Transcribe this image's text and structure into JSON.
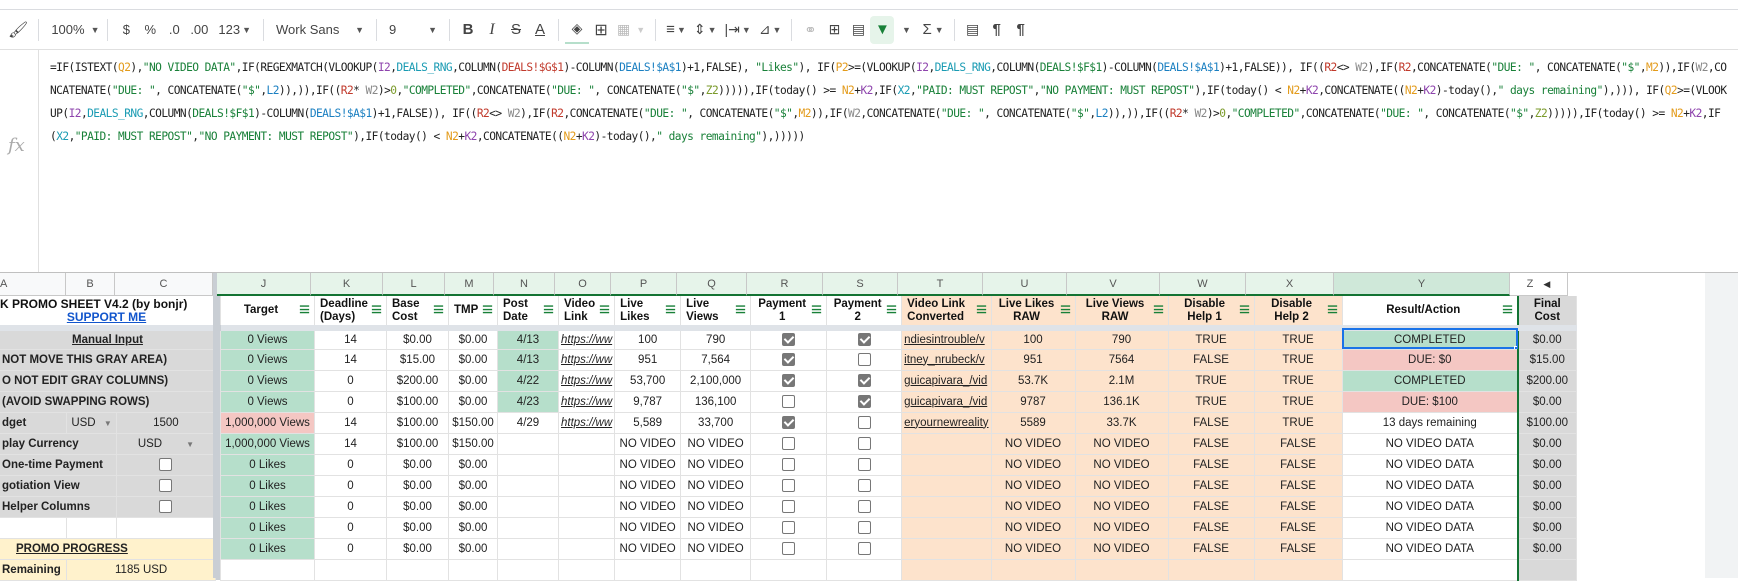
{
  "toolbar": {
    "zoom": "100%",
    "currency": "$",
    "percent": "%",
    "dec_decrease": ".0",
    "dec_increase": ".00",
    "format_more": "123",
    "font": "Work Sans",
    "font_size": "9",
    "bold": "B",
    "italic": "I",
    "strike": "S",
    "text_color": "A",
    "sum": "Σ",
    "para1": "¶",
    "para2": "¶"
  },
  "formula_bar": {
    "fx": "fx",
    "segments": [
      [
        "=IF(ISTEXT(",
        ""
      ],
      [
        "Q2",
        "c-orange"
      ],
      [
        "),",
        ""
      ],
      [
        "\"NO VIDEO DATA\"",
        "c-green"
      ],
      [
        ",IF(REGEXMATCH(VLOOKUP(",
        ""
      ],
      [
        "I2",
        "c-purple"
      ],
      [
        ",",
        ""
      ],
      [
        "DEALS_RNG",
        "c-teal"
      ],
      [
        ",COLUMN(",
        ""
      ],
      [
        "DEALS!$G$1",
        "c-red"
      ],
      [
        ")-COLUMN(",
        ""
      ],
      [
        "DEALS!$A$1",
        "c-blue"
      ],
      [
        ")+1,FALSE), ",
        ""
      ],
      [
        "\"Likes\"",
        "c-green"
      ],
      [
        "), IF(",
        ""
      ],
      [
        "P2",
        "c-orange"
      ],
      [
        ">=(VLOOKUP(",
        ""
      ],
      [
        "I2",
        "c-purple"
      ],
      [
        ",",
        ""
      ],
      [
        "DEALS_RNG",
        "c-teal"
      ],
      [
        ",COLUMN(",
        ""
      ],
      [
        "DEALS!$F$1",
        "c-green"
      ],
      [
        ")-COLUMN(",
        ""
      ],
      [
        "DEALS!$A$1",
        "c-blue"
      ],
      [
        ")+1,FALSE)), IF((",
        ""
      ],
      [
        "R2",
        "c-red"
      ],
      [
        "<> ",
        ""
      ],
      [
        "W2",
        "c-gray"
      ],
      [
        "),IF(",
        ""
      ],
      [
        "R2",
        "c-red"
      ],
      [
        ",CONCATENATE(",
        ""
      ],
      [
        "\"DUE: \"",
        "c-green"
      ],
      [
        ", CONCATENATE(",
        ""
      ],
      [
        "\"$\"",
        "c-green"
      ],
      [
        ",",
        ""
      ],
      [
        "M2",
        "c-orange"
      ],
      [
        ")),IF(",
        ""
      ],
      [
        "W2",
        "c-gray"
      ],
      [
        ",CONCATENATE(",
        ""
      ],
      [
        "\"DUE: \"",
        "c-green"
      ],
      [
        ", CONCATENATE(",
        ""
      ],
      [
        "\"$\"",
        "c-green"
      ],
      [
        ",",
        ""
      ],
      [
        "L2",
        "c-blue"
      ],
      [
        ")),)),IF((",
        ""
      ],
      [
        "R2",
        "c-red"
      ],
      [
        "* ",
        ""
      ],
      [
        "W2",
        "c-gray"
      ],
      [
        ")>",
        ""
      ],
      [
        "0",
        "c-olive"
      ],
      [
        ",",
        ""
      ],
      [
        "\"COMPLETED\"",
        "c-green"
      ],
      [
        ",CONCATENATE(",
        ""
      ],
      [
        "\"DUE: \"",
        "c-green"
      ],
      [
        ", CONCATENATE(",
        ""
      ],
      [
        "\"$\"",
        "c-green"
      ],
      [
        ",",
        ""
      ],
      [
        "Z2",
        "c-olive"
      ],
      [
        "))))),IF(today() >= ",
        ""
      ],
      [
        "N2",
        "c-orange"
      ],
      [
        "+",
        ""
      ],
      [
        "K2",
        "c-purple"
      ],
      [
        ",IF(",
        ""
      ],
      [
        "X2",
        "c-teal"
      ],
      [
        ",",
        ""
      ],
      [
        "\"PAID: MUST REPOST\"",
        "c-green"
      ],
      [
        ",",
        ""
      ],
      [
        "\"NO PAYMENT: MUST REPOST\"",
        "c-green"
      ],
      [
        "),IF(today() < ",
        ""
      ],
      [
        "N2",
        "c-orange"
      ],
      [
        "+",
        ""
      ],
      [
        "K2",
        "c-purple"
      ],
      [
        ",CONCATENATE((",
        ""
      ],
      [
        "N2",
        "c-orange"
      ],
      [
        "+",
        ""
      ],
      [
        "K2",
        "c-purple"
      ],
      [
        ")-today(),",
        ""
      ],
      [
        "\" days remaining\"",
        "c-green"
      ],
      [
        "),))), IF(",
        ""
      ],
      [
        "Q2",
        "c-orange"
      ],
      [
        ">=(VLOOKUP(",
        ""
      ],
      [
        "I2",
        "c-purple"
      ],
      [
        ",",
        ""
      ],
      [
        "DEALS_RNG",
        "c-teal"
      ],
      [
        ",COLUMN(",
        ""
      ],
      [
        "DEALS!$F$1",
        "c-green"
      ],
      [
        ")-COLUMN(",
        ""
      ],
      [
        "DEALS!$A$1",
        "c-blue"
      ],
      [
        ")+1,FALSE)), IF((",
        ""
      ],
      [
        "R2",
        "c-red"
      ],
      [
        "<> ",
        ""
      ],
      [
        "W2",
        "c-gray"
      ],
      [
        "),IF(",
        ""
      ],
      [
        "R2",
        "c-red"
      ],
      [
        ",CONCATENATE(",
        ""
      ],
      [
        "\"DUE: \"",
        "c-green"
      ],
      [
        ", CONCATENATE(",
        ""
      ],
      [
        "\"$\"",
        "c-green"
      ],
      [
        ",",
        ""
      ],
      [
        "M2",
        "c-orange"
      ],
      [
        ")),IF(",
        ""
      ],
      [
        "W2",
        "c-gray"
      ],
      [
        ",CONCATENATE(",
        ""
      ],
      [
        "\"DUE: \"",
        "c-green"
      ],
      [
        ", CONCATENATE(",
        ""
      ],
      [
        "\"$\"",
        "c-green"
      ],
      [
        ",",
        ""
      ],
      [
        "L2",
        "c-blue"
      ],
      [
        ")),)),IF((",
        ""
      ],
      [
        "R2",
        "c-red"
      ],
      [
        "* ",
        ""
      ],
      [
        "W2",
        "c-gray"
      ],
      [
        ")>",
        ""
      ],
      [
        "0",
        "c-olive"
      ],
      [
        ",",
        ""
      ],
      [
        "\"COMPLETED\"",
        "c-green"
      ],
      [
        ",CONCATENATE(",
        ""
      ],
      [
        "\"DUE: \"",
        "c-green"
      ],
      [
        ", CONCATENATE(",
        ""
      ],
      [
        "\"$\"",
        "c-green"
      ],
      [
        ",",
        ""
      ],
      [
        "Z2",
        "c-olive"
      ],
      [
        "))))),IF(today() >= ",
        ""
      ],
      [
        "N2",
        "c-orange"
      ],
      [
        "+",
        ""
      ],
      [
        "K2",
        "c-purple"
      ],
      [
        ",IF(",
        ""
      ],
      [
        "X2",
        "c-teal"
      ],
      [
        ",",
        ""
      ],
      [
        "\"PAID: MUST REPOST\"",
        "c-green"
      ],
      [
        ",",
        ""
      ],
      [
        "\"NO PAYMENT: MUST REPOST\"",
        "c-green"
      ],
      [
        "),IF(today() < ",
        ""
      ],
      [
        "N2",
        "c-orange"
      ],
      [
        "+",
        ""
      ],
      [
        "K2",
        "c-purple"
      ],
      [
        ",CONCATENATE((",
        ""
      ],
      [
        "N2",
        "c-orange"
      ],
      [
        "+",
        ""
      ],
      [
        "K2",
        "c-purple"
      ],
      [
        ")-today(),",
        ""
      ],
      [
        "\" days remaining\"",
        "c-green"
      ],
      [
        "),)))))",
        ""
      ]
    ]
  },
  "columns": [
    "A",
    "B",
    "C",
    "J",
    "K",
    "L",
    "M",
    "N",
    "O",
    "P",
    "Q",
    "R",
    "S",
    "T",
    "U",
    "V",
    "W",
    "X",
    "Y",
    "Z"
  ],
  "left_panel": {
    "title": "K PROMO SHEET V4.2 (by bonjr)",
    "support_link": "SUPPORT ME",
    "rows": [
      {
        "label": "Manual Input",
        "style": "manual"
      },
      {
        "label": "NOT MOVE THIS GRAY AREA)",
        "style": "warn"
      },
      {
        "label": "O NOT EDIT GRAY COLUMNS)",
        "style": "warn"
      },
      {
        "label": "(AVOID SWAPPING ROWS)",
        "style": "warn"
      },
      {
        "label": "dget",
        "b": "USD",
        "c": "1500",
        "style": "budget"
      },
      {
        "label": "play Currency",
        "c": "USD",
        "style": "currency"
      },
      {
        "label": "One-time Payment",
        "checkbox": false,
        "style": "check"
      },
      {
        "label": "gotiation View",
        "checkbox": false,
        "style": "check"
      },
      {
        "label": "Helper Columns",
        "checkbox": false,
        "style": "check"
      },
      {
        "label": "",
        "style": "blank"
      },
      {
        "label": "PROMO PROGRESS",
        "style": "progress"
      },
      {
        "label": "Remaining",
        "c": "1185 USD",
        "style": "remaining"
      }
    ]
  },
  "headers": {
    "J": "Target",
    "K": "Deadline (Days)",
    "L": "Base Cost",
    "M": "TMP",
    "N": "Post Date",
    "O": "Video Link",
    "P": "Live Likes",
    "Q": "Live Views",
    "R": "Payment 1",
    "S": "Payment 2",
    "T": "Video Link Converted",
    "U": "Live Likes RAW",
    "V": "Live Views RAW",
    "W": "Disable Help 1",
    "X": "Disable Help 2",
    "Y": "Result/Action",
    "Z": "Final Cost"
  },
  "rows": [
    {
      "J": "0 Views",
      "K": "14",
      "L": "$0.00",
      "M": "$0.00",
      "N": "4/13",
      "O": "https://ww",
      "P": "100",
      "Q": "790",
      "R": true,
      "S": true,
      "T": "ndiesintrouble/v",
      "U": "100",
      "V": "790",
      "W": "TRUE",
      "X": "TRUE",
      "Y": "COMPLETED",
      "Y_status": "green",
      "Z": "$0.00",
      "J_status": "green",
      "N_status": "green"
    },
    {
      "J": "0 Views",
      "K": "14",
      "L": "$15.00",
      "M": "$0.00",
      "N": "4/13",
      "O": "https://ww",
      "P": "951",
      "Q": "7,564",
      "R": true,
      "S": false,
      "T": "itney_nrubeck/v",
      "U": "951",
      "V": "7564",
      "W": "FALSE",
      "X": "TRUE",
      "Y": "DUE: $0",
      "Y_status": "pink",
      "Z": "$15.00",
      "J_status": "green",
      "N_status": "green"
    },
    {
      "J": "0 Views",
      "K": "0",
      "L": "$200.00",
      "M": "$0.00",
      "N": "4/22",
      "O": "https://ww",
      "P": "53,700",
      "Q": "2,100,000",
      "R": true,
      "S": true,
      "T": "guicapivara_/vid",
      "U": "53.7K",
      "V": "2.1M",
      "W": "TRUE",
      "X": "TRUE",
      "Y": "COMPLETED",
      "Y_status": "green",
      "Z": "$200.00",
      "J_status": "green",
      "N_status": "green"
    },
    {
      "J": "0 Views",
      "K": "0",
      "L": "$100.00",
      "M": "$0.00",
      "N": "4/23",
      "O": "https://ww",
      "P": "9,787",
      "Q": "136,100",
      "R": false,
      "S": true,
      "T": "guicapivara_/vid",
      "U": "9787",
      "V": "136.1K",
      "W": "TRUE",
      "X": "TRUE",
      "Y": "DUE: $100",
      "Y_status": "pink",
      "Z": "$0.00",
      "J_status": "green",
      "N_status": "green"
    },
    {
      "J": "1,000,000 Views",
      "K": "14",
      "L": "$100.00",
      "M": "$150.00",
      "N": "4/29",
      "O": "https://ww",
      "P": "5,589",
      "Q": "33,700",
      "R": true,
      "S": false,
      "T": "eryournewreality",
      "U": "5589",
      "V": "33.7K",
      "W": "FALSE",
      "X": "TRUE",
      "Y": "13 days remaining",
      "Y_status": "white",
      "Z": "$100.00",
      "J_status": "pink",
      "N_status": "white"
    },
    {
      "J": "1,000,000 Views",
      "K": "14",
      "L": "$100.00",
      "M": "$150.00",
      "N": "",
      "O": "",
      "P": "NO VIDEO",
      "Q": "NO VIDEO",
      "R": false,
      "S": false,
      "T": "",
      "U": "NO VIDEO",
      "V": "NO VIDEO",
      "W": "FALSE",
      "X": "FALSE",
      "Y": "NO VIDEO DATA",
      "Y_status": "white",
      "Z": "$0.00",
      "J_status": "green",
      "N_status": "white"
    },
    {
      "J": "0 Likes",
      "K": "0",
      "L": "$0.00",
      "M": "$0.00",
      "N": "",
      "O": "",
      "P": "NO VIDEO",
      "Q": "NO VIDEO",
      "R": false,
      "S": false,
      "T": "",
      "U": "NO VIDEO",
      "V": "NO VIDEO",
      "W": "FALSE",
      "X": "FALSE",
      "Y": "NO VIDEO DATA",
      "Y_status": "white",
      "Z": "$0.00",
      "J_status": "green",
      "N_status": "white"
    },
    {
      "J": "0 Likes",
      "K": "0",
      "L": "$0.00",
      "M": "$0.00",
      "N": "",
      "O": "",
      "P": "NO VIDEO",
      "Q": "NO VIDEO",
      "R": false,
      "S": false,
      "T": "",
      "U": "NO VIDEO",
      "V": "NO VIDEO",
      "W": "FALSE",
      "X": "FALSE",
      "Y": "NO VIDEO DATA",
      "Y_status": "white",
      "Z": "$0.00",
      "J_status": "green",
      "N_status": "white"
    },
    {
      "J": "0 Likes",
      "K": "0",
      "L": "$0.00",
      "M": "$0.00",
      "N": "",
      "O": "",
      "P": "NO VIDEO",
      "Q": "NO VIDEO",
      "R": false,
      "S": false,
      "T": "",
      "U": "NO VIDEO",
      "V": "NO VIDEO",
      "W": "FALSE",
      "X": "FALSE",
      "Y": "NO VIDEO DATA",
      "Y_status": "white",
      "Z": "$0.00",
      "J_status": "green",
      "N_status": "white"
    },
    {
      "J": "0 Likes",
      "K": "0",
      "L": "$0.00",
      "M": "$0.00",
      "N": "",
      "O": "",
      "P": "NO VIDEO",
      "Q": "NO VIDEO",
      "R": false,
      "S": false,
      "T": "",
      "U": "NO VIDEO",
      "V": "NO VIDEO",
      "W": "FALSE",
      "X": "FALSE",
      "Y": "NO VIDEO DATA",
      "Y_status": "white",
      "Z": "$0.00",
      "J_status": "green",
      "N_status": "white"
    },
    {
      "J": "0 Likes",
      "K": "0",
      "L": "$0.00",
      "M": "$0.00",
      "N": "",
      "O": "",
      "P": "NO VIDEO",
      "Q": "NO VIDEO",
      "R": false,
      "S": false,
      "T": "",
      "U": "NO VIDEO",
      "V": "NO VIDEO",
      "W": "FALSE",
      "X": "FALSE",
      "Y": "NO VIDEO DATA",
      "Y_status": "white",
      "Z": "$0.00",
      "J_status": "green",
      "N_status": "white"
    },
    {
      "J": "",
      "K": "",
      "L": "",
      "M": "",
      "N": "",
      "O": "",
      "P": "",
      "Q": "",
      "R": null,
      "S": null,
      "T": "",
      "U": "",
      "V": "",
      "W": "",
      "X": "",
      "Y": "",
      "Y_status": "white",
      "Z": "",
      "J_status": "white",
      "N_status": "white"
    }
  ],
  "selected_cell": "Y2",
  "colors": {
    "green_fill": "#b6dfcb",
    "pink_fill": "#f4c7c3",
    "peach_fill": "#fde3cc",
    "gray_fill": "#d9d9d9",
    "filter_active": "#188038",
    "selection": "#1a73e8"
  }
}
